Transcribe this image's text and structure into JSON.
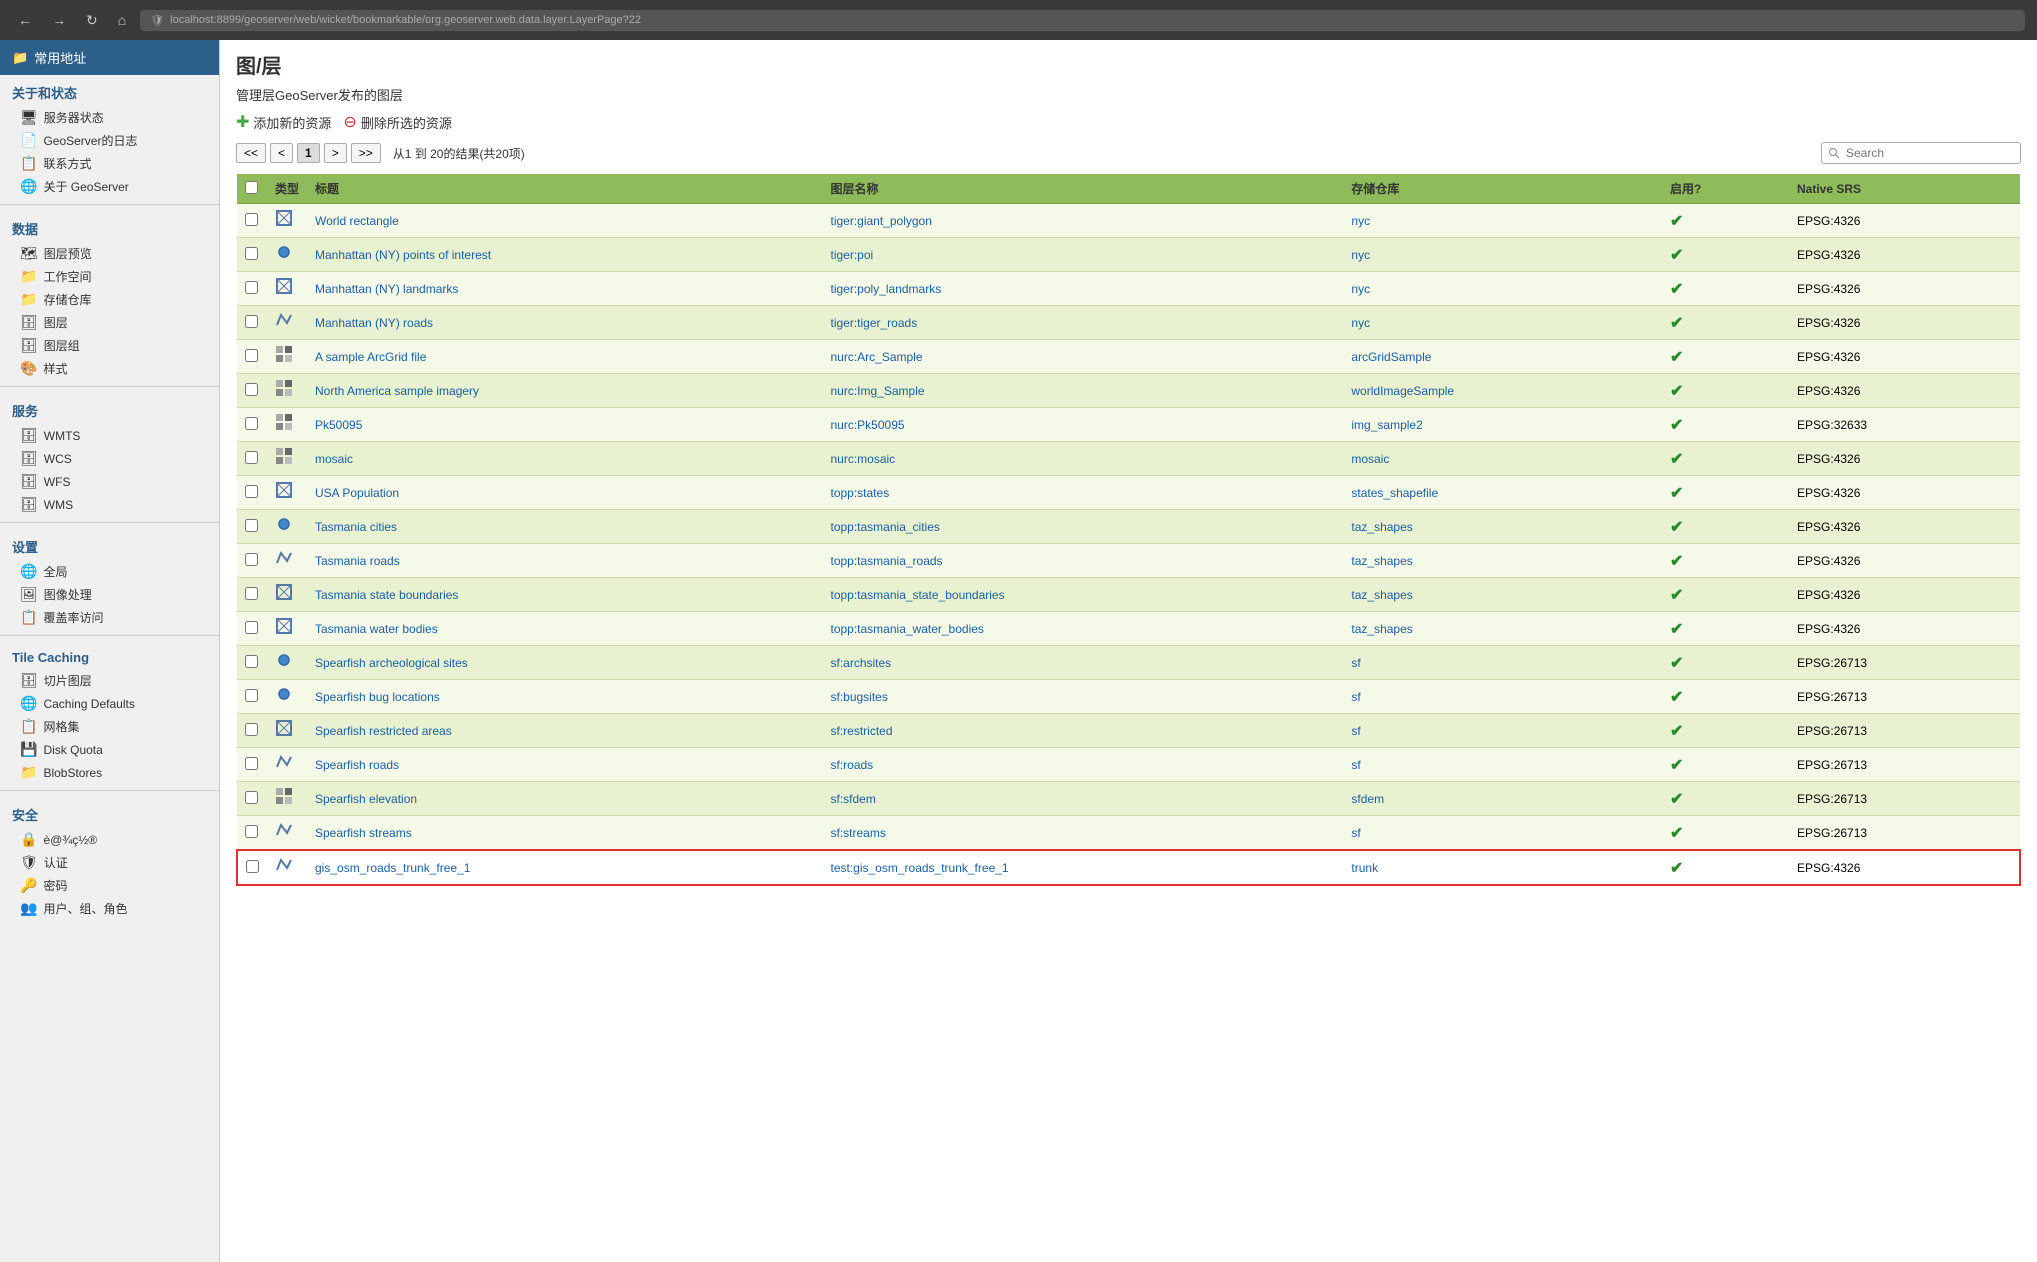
{
  "browser": {
    "url": "localhost:8899/geoserver/web/wicket/bookmarkable/org.geoserver.web.data.layer.LayerPage?22",
    "back_label": "←",
    "forward_label": "→",
    "refresh_label": "↻",
    "home_label": "⌂"
  },
  "sidebar": {
    "bookmarks_label": "常用地址",
    "sections": [
      {
        "title": "关于和状态",
        "items": [
          {
            "id": "server-status",
            "label": "服务器状态",
            "icon": "🖥"
          },
          {
            "id": "geoserver-log",
            "label": "GeoServer的日志",
            "icon": "📄"
          },
          {
            "id": "contact",
            "label": "联系方式",
            "icon": "📋"
          },
          {
            "id": "about",
            "label": "关于 GeoServer",
            "icon": "🌐"
          }
        ]
      },
      {
        "title": "数据",
        "items": [
          {
            "id": "layer-preview",
            "label": "图层预览",
            "icon": "🗺"
          },
          {
            "id": "workspace",
            "label": "工作空间",
            "icon": "📁"
          },
          {
            "id": "store",
            "label": "存储仓库",
            "icon": "📁"
          },
          {
            "id": "layer",
            "label": "图层",
            "icon": "🗄"
          },
          {
            "id": "layer-group",
            "label": "图层组",
            "icon": "🗄"
          },
          {
            "id": "style",
            "label": "样式",
            "icon": "🎨"
          }
        ]
      },
      {
        "title": "服务",
        "items": [
          {
            "id": "wmts",
            "label": "WMTS",
            "icon": "🗄"
          },
          {
            "id": "wcs",
            "label": "WCS",
            "icon": "🗄"
          },
          {
            "id": "wfs",
            "label": "WFS",
            "icon": "🗄"
          },
          {
            "id": "wms",
            "label": "WMS",
            "icon": "🗄"
          }
        ]
      },
      {
        "title": "设置",
        "items": [
          {
            "id": "global",
            "label": "全局",
            "icon": "🌐"
          },
          {
            "id": "image-processing",
            "label": "图像处理",
            "icon": "🖼"
          },
          {
            "id": "coverage",
            "label": "覆盖率访问",
            "icon": "📋"
          }
        ]
      },
      {
        "title": "Tile Caching",
        "items": [
          {
            "id": "tile-layers",
            "label": "切片图层",
            "icon": "🗄"
          },
          {
            "id": "caching-defaults",
            "label": "Caching Defaults",
            "icon": "🌐"
          },
          {
            "id": "gridsets",
            "label": "网格集",
            "icon": "📋"
          },
          {
            "id": "disk-quota",
            "label": "Disk Quota",
            "icon": "💾"
          },
          {
            "id": "blobstores",
            "label": "BlobStores",
            "icon": "📁"
          }
        ]
      },
      {
        "title": "安全",
        "items": [
          {
            "id": "security-settings",
            "label": "è@¾ç½®",
            "icon": "🔒"
          },
          {
            "id": "auth",
            "label": "认证",
            "icon": "🛡"
          },
          {
            "id": "password",
            "label": "密码",
            "icon": "🔑"
          },
          {
            "id": "users",
            "label": "用户、组、角色",
            "icon": "👥"
          }
        ]
      }
    ]
  },
  "main": {
    "title": "图/层",
    "subtitle": "管理层GeoServer发布的图层",
    "add_resource_label": "添加新的资源",
    "delete_selected_label": "删除所选的资源",
    "pagination": {
      "first": "<<",
      "prev": "<",
      "current": "1",
      "next": ">",
      "last": ">>",
      "info": "从1 到 20的结果(共20项)"
    },
    "search_placeholder": "Search",
    "table": {
      "headers": [
        "",
        "类型",
        "标题",
        "图层名称",
        "存储仓库",
        "启用?",
        "Native SRS"
      ],
      "rows": [
        {
          "id": 1,
          "type": "polygon",
          "title": "World rectangle",
          "layer_name": "tiger:giant_polygon",
          "store": "nyc",
          "enabled": true,
          "srs": "EPSG:4326",
          "highlight": false
        },
        {
          "id": 2,
          "type": "point",
          "title": "Manhattan (NY) points of interest",
          "layer_name": "tiger:poi",
          "store": "nyc",
          "enabled": true,
          "srs": "EPSG:4326",
          "highlight": false
        },
        {
          "id": 3,
          "type": "polygon",
          "title": "Manhattan (NY) landmarks",
          "layer_name": "tiger:poly_landmarks",
          "store": "nyc",
          "enabled": true,
          "srs": "EPSG:4326",
          "highlight": false
        },
        {
          "id": 4,
          "type": "line",
          "title": "Manhattan (NY) roads",
          "layer_name": "tiger:tiger_roads",
          "store": "nyc",
          "enabled": true,
          "srs": "EPSG:4326",
          "highlight": false
        },
        {
          "id": 5,
          "type": "raster",
          "title": "A sample ArcGrid file",
          "layer_name": "nurc:Arc_Sample",
          "store": "arcGridSample",
          "enabled": true,
          "srs": "EPSG:4326",
          "highlight": false
        },
        {
          "id": 6,
          "type": "raster",
          "title": "North America sample imagery",
          "layer_name": "nurc:Img_Sample",
          "store": "worldImageSample",
          "enabled": true,
          "srs": "EPSG:4326",
          "highlight": false
        },
        {
          "id": 7,
          "type": "raster",
          "title": "Pk50095",
          "layer_name": "nurc:Pk50095",
          "store": "img_sample2",
          "enabled": true,
          "srs": "EPSG:32633",
          "highlight": false
        },
        {
          "id": 8,
          "type": "raster",
          "title": "mosaic",
          "layer_name": "nurc:mosaic",
          "store": "mosaic",
          "enabled": true,
          "srs": "EPSG:4326",
          "highlight": false
        },
        {
          "id": 9,
          "type": "polygon",
          "title": "USA Population",
          "layer_name": "topp:states",
          "store": "states_shapefile",
          "enabled": true,
          "srs": "EPSG:4326",
          "highlight": false
        },
        {
          "id": 10,
          "type": "point",
          "title": "Tasmania cities",
          "layer_name": "topp:tasmania_cities",
          "store": "taz_shapes",
          "enabled": true,
          "srs": "EPSG:4326",
          "highlight": false
        },
        {
          "id": 11,
          "type": "line",
          "title": "Tasmania roads",
          "layer_name": "topp:tasmania_roads",
          "store": "taz_shapes",
          "enabled": true,
          "srs": "EPSG:4326",
          "highlight": false
        },
        {
          "id": 12,
          "type": "polygon",
          "title": "Tasmania state boundaries",
          "layer_name": "topp:tasmania_state_boundaries",
          "store": "taz_shapes",
          "enabled": true,
          "srs": "EPSG:4326",
          "highlight": false
        },
        {
          "id": 13,
          "type": "polygon",
          "title": "Tasmania water bodies",
          "layer_name": "topp:tasmania_water_bodies",
          "store": "taz_shapes",
          "enabled": true,
          "srs": "EPSG:4326",
          "highlight": false
        },
        {
          "id": 14,
          "type": "point",
          "title": "Spearfish archeological sites",
          "layer_name": "sf:archsites",
          "store": "sf",
          "enabled": true,
          "srs": "EPSG:26713",
          "highlight": false
        },
        {
          "id": 15,
          "type": "point",
          "title": "Spearfish bug locations",
          "layer_name": "sf:bugsites",
          "store": "sf",
          "enabled": true,
          "srs": "EPSG:26713",
          "highlight": false
        },
        {
          "id": 16,
          "type": "polygon",
          "title": "Spearfish restricted areas",
          "layer_name": "sf:restricted",
          "store": "sf",
          "enabled": true,
          "srs": "EPSG:26713",
          "highlight": false
        },
        {
          "id": 17,
          "type": "line",
          "title": "Spearfish roads",
          "layer_name": "sf:roads",
          "store": "sf",
          "enabled": true,
          "srs": "EPSG:26713",
          "highlight": false
        },
        {
          "id": 18,
          "type": "raster",
          "title": "Spearfish elevation",
          "layer_name": "sf:sfdem",
          "store": "sfdem",
          "enabled": true,
          "srs": "EPSG:26713",
          "highlight": false
        },
        {
          "id": 19,
          "type": "line",
          "title": "Spearfish streams",
          "layer_name": "sf:streams",
          "store": "sf",
          "enabled": true,
          "srs": "EPSG:26713",
          "highlight": false
        },
        {
          "id": 20,
          "type": "line",
          "title": "gis_osm_roads_trunk_free_1",
          "layer_name": "test:gis_osm_roads_trunk_free_1",
          "store": "trunk",
          "enabled": true,
          "srs": "EPSG:4326",
          "highlight": true
        }
      ]
    }
  }
}
